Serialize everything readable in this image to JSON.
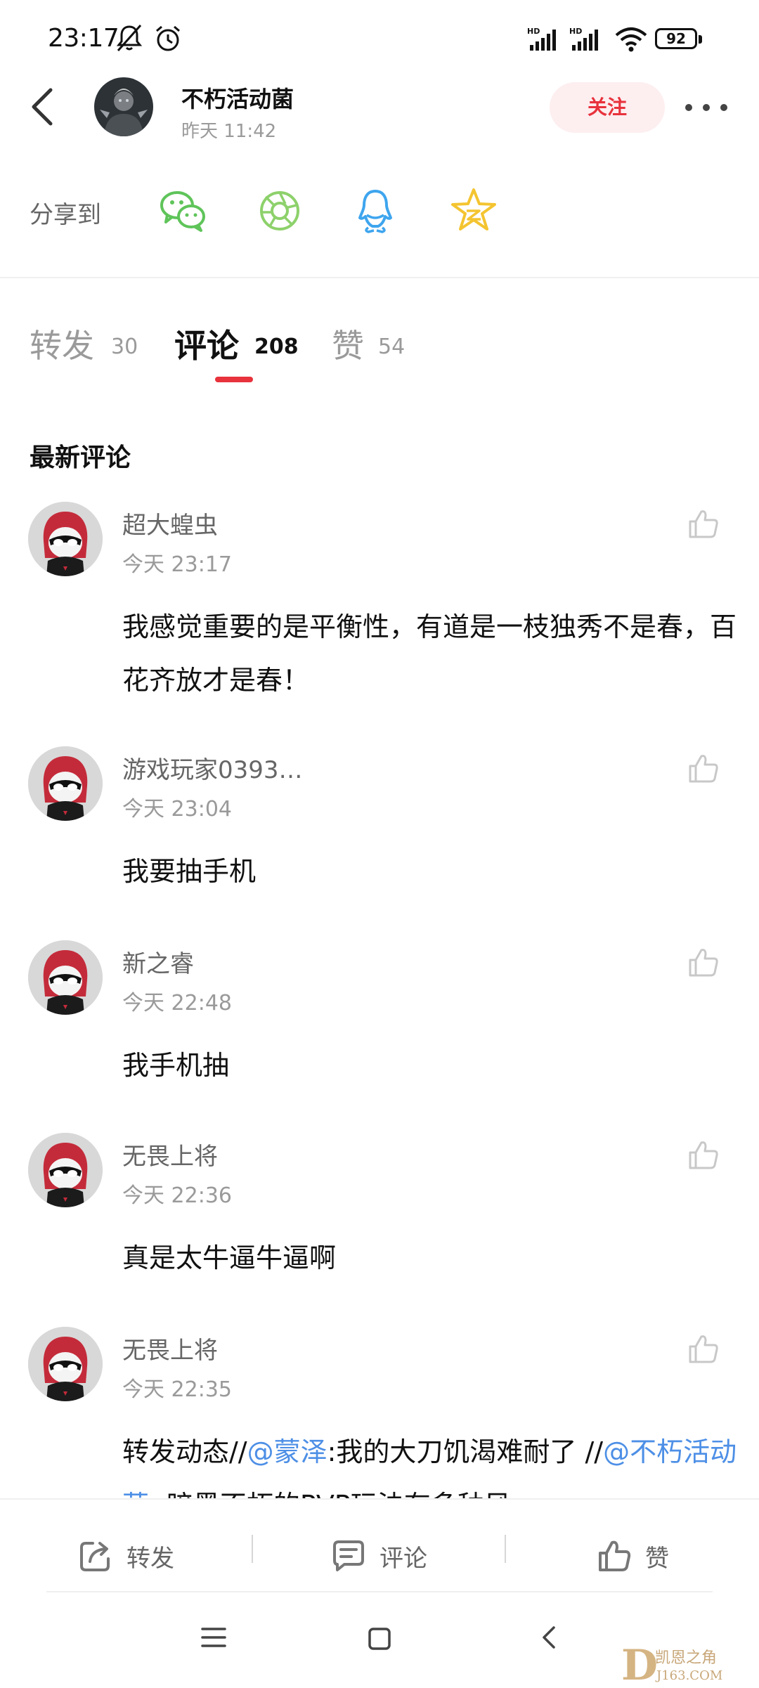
{
  "status_bar": {
    "time": "23:17",
    "battery": "92",
    "network_1": "HD",
    "network_2": "HD"
  },
  "header": {
    "author_name": "不朽活动菌",
    "author_time": "昨天 11:42",
    "follow_label": "关注"
  },
  "share": {
    "label": "分享到",
    "icons": [
      "wechat-icon",
      "moments-icon",
      "qq-icon",
      "qzone-icon"
    ]
  },
  "tabs": [
    {
      "label": "转发",
      "count": "30",
      "active": false
    },
    {
      "label": "评论",
      "count": "208",
      "active": true
    },
    {
      "label": "赞",
      "count": "54",
      "active": false
    }
  ],
  "section_title": "最新评论",
  "comments": [
    {
      "name": "超大蝗虫",
      "time": "今天 23:17",
      "text": "我感觉重要的是平衡性，有道是一枝独秀不是春，百花齐放才是春！"
    },
    {
      "name": "游戏玩家0393…",
      "time": "今天 23:04",
      "text": "我要抽手机"
    },
    {
      "name": "新之睿",
      "time": "今天 22:48",
      "text": "我手机抽"
    },
    {
      "name": "无畏上将",
      "time": "今天 22:36",
      "text": "真是太牛逼牛逼啊"
    },
    {
      "name": "无畏上将",
      "time": "今天 22:35",
      "text_prefix": "转发动态//",
      "mention_1": "@蒙泽",
      "text_mid": ":我的大刀饥渴难耐了  //",
      "mention_2": "@不朽活动菌",
      "text_suffix": ": 暗黑不朽的PVP玩法有多种风"
    }
  ],
  "bottom_actions": {
    "repost": "转发",
    "comment": "评论",
    "like": "赞"
  },
  "watermark": {
    "line1": "凯恩之角",
    "line2": "J163.COM"
  },
  "colors": {
    "accent": "#e8323c",
    "follow_bg": "#fdeef0",
    "mention": "#4d8fe6",
    "muted": "#9a9a9a"
  }
}
